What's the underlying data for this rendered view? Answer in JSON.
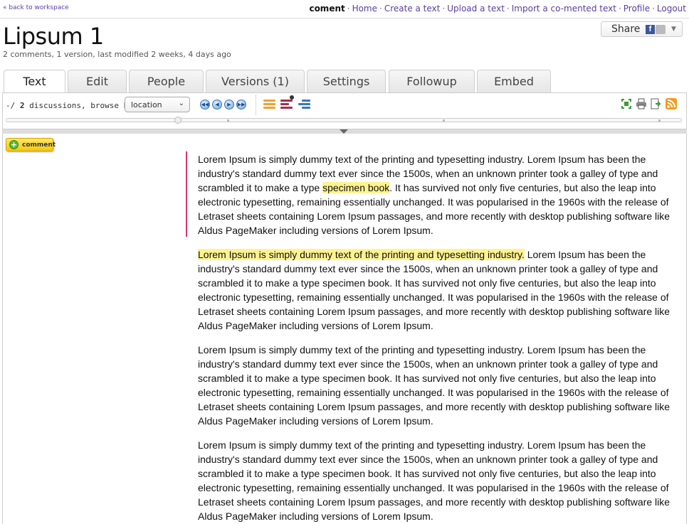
{
  "topbar": {
    "back_label": "« back to workspace",
    "brand": "coment",
    "links": [
      "Home",
      "Create a text",
      "Upload a text",
      "Import a co-mented text",
      "Profile",
      "Logout"
    ]
  },
  "document": {
    "title": "Lipsum 1",
    "meta": "2 comments, 1 version, last modified 2 weeks, 4 days ago"
  },
  "share": {
    "label": "Share",
    "facebook_glyph": "f",
    "icons": [
      "facebook-icon",
      "share-generic-icon",
      "caret-down-icon"
    ]
  },
  "tabs": [
    {
      "label": "Text",
      "active": true
    },
    {
      "label": "Edit",
      "active": false
    },
    {
      "label": "People",
      "active": false
    },
    {
      "label": "Versions (1)",
      "active": false
    },
    {
      "label": "Settings",
      "active": false
    },
    {
      "label": "Followup",
      "active": false
    },
    {
      "label": "Embed",
      "active": false
    }
  ],
  "toolbar": {
    "disc_prefix": "-/ ",
    "disc_count": "2",
    "disc_suffix": " discussions, browse by:",
    "browse_value": "location",
    "nav_icons": [
      "first-icon",
      "prev-icon",
      "next-icon",
      "last-icon"
    ],
    "nav_glyphs": [
      "◀◀",
      "◀",
      "▶",
      "▶▶"
    ],
    "view_icons": [
      "view-list-icon",
      "view-threads-icon",
      "view-indent-icon"
    ],
    "right_icons": [
      "fullscreen-icon",
      "print-icon",
      "export-icon",
      "rss-icon"
    ],
    "colors": {
      "orange": "#f0a030",
      "maroon": "#a0304a",
      "blue": "#3c78b8",
      "rss": "#f39a1d",
      "green": "#3a9a3a"
    }
  },
  "comment_button": {
    "label": "comment"
  },
  "content": {
    "p1_a": "Lorem Ipsum is simply dummy text of the printing and typesetting industry. Lorem Ipsum has been the industry's standard dummy text ever since the 1500s, when an unknown printer took a galley of type and scrambled it to make a type ",
    "p1_hl": "specimen book",
    "p1_b": ". It has survived not only five centuries, but also the leap into electronic typesetting, remaining essentially unchanged. It was popularised in the 1960s with the release of Letraset sheets containing Lorem Ipsum passages, and more recently with desktop publishing software like Aldus PageMaker including versions of Lorem Ipsum.",
    "p2_hl": "Lorem Ipsum is simply dummy text of the printing and typesetting industry.",
    "p2_b": " Lorem Ipsum has been the industry's standard dummy text ever since the 1500s, when an unknown printer took a galley of type and scrambled it to make a type specimen book. It has survived not only five centuries, but also the leap into electronic typesetting, remaining essentially unchanged. It was popularised in the 1960s with the release of Letraset sheets containing Lorem Ipsum passages, and more recently with desktop publishing software like Aldus PageMaker including versions of Lorem Ipsum.",
    "p3": "Lorem Ipsum is simply dummy text of the printing and typesetting industry. Lorem Ipsum has been the industry's standard dummy text ever since the 1500s, when an unknown printer took a galley of type and scrambled it to make a type specimen book. It has survived not only five centuries, but also the leap into electronic typesetting, remaining essentially unchanged. It was popularised in the 1960s with the release of Letraset sheets containing Lorem Ipsum passages, and more recently with desktop publishing software like Aldus PageMaker including versions of Lorem Ipsum.",
    "p4": "Lorem Ipsum is simply dummy text of the printing and typesetting industry. Lorem Ipsum has been the industry's standard dummy text ever since the 1500s, when an unknown printer took a galley of type and scrambled it to make a type specimen book. It has survived not only five centuries, but also the leap into electronic typesetting, remaining essentially unchanged. It was popularised in the 1960s with the release of Letraset sheets containing Lorem Ipsum passages, and more recently with desktop publishing software like Aldus PageMaker including versions of Lorem Ipsum."
  }
}
